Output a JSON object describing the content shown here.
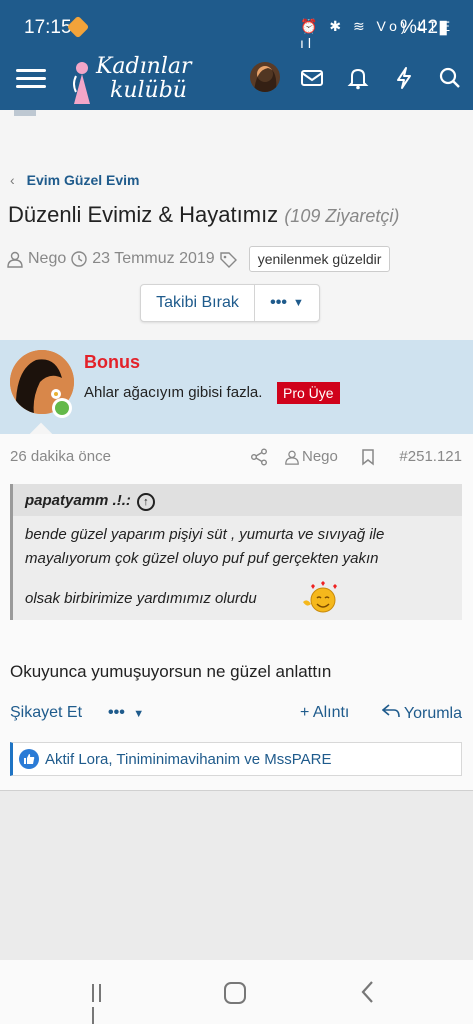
{
  "status_bar": {
    "time": "17:15",
    "icons": "⏰ ✱ ≋ Vo) LTE ıl",
    "battery": "%42▮"
  },
  "header": {
    "logo_line1": "Kadınlar",
    "logo_line2": "kulübü"
  },
  "breadcrumb": {
    "label": "Evim Güzel Evim"
  },
  "thread": {
    "title": "Düzenli Evimiz & Hayatımız",
    "views": "(109 Ziyaretçi)",
    "author": "Nego",
    "date": "23 Temmuz 2019",
    "tag": "yenilenmek güzeldir",
    "follow_label": "Takibi Bırak",
    "more_label": "•••"
  },
  "post": {
    "username": "Bonus",
    "user_title": "Ahlar ağacıyım gibisi fazla.",
    "badge": "Pro Üye",
    "time_ago": "26 dakika önce",
    "meta_user": "Nego",
    "post_number": "#251.121",
    "quote": {
      "author": "papatyamm .!.:",
      "line1": "bende güzel yaparım pişiyi süt , yumurta ve sıvıyağ ile",
      "line2": "mayalıyorum çok güzel oluyo puf puf gerçekten yakın",
      "line3": "olsak birbirimize yardımımız olurdu"
    },
    "message": "Okuyunca yumuşuyorsun ne güzel anlattın",
    "actions": {
      "report": "Şikayet Et",
      "more": "•••",
      "quote": "+ Alıntı",
      "reply": "Yorumla"
    },
    "reactions": "Aktif Lora, Tiniminimavihanim ve MssPARE"
  }
}
